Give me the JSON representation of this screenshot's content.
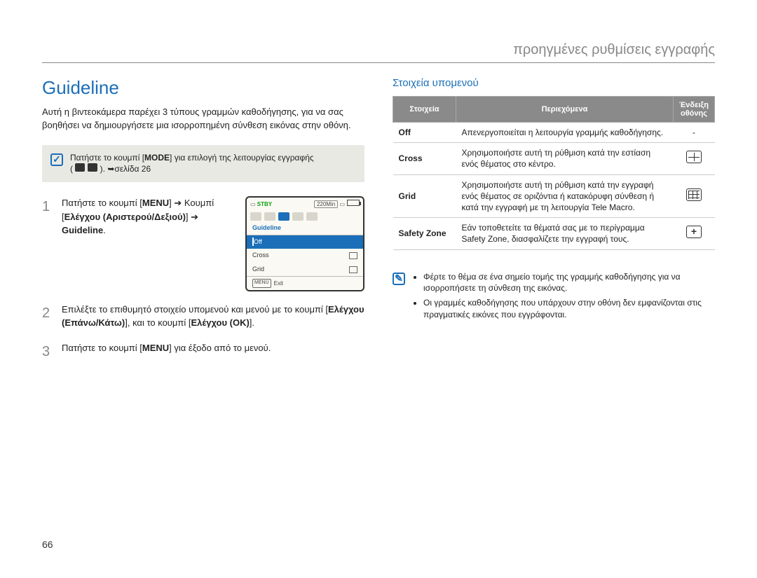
{
  "chapter": "προηγμένες ρυθμίσεις εγγραφής",
  "section_title": "Guideline",
  "intro": "Αυτή η βιντεοκάμερα παρέχει 3 τύπους γραμμών καθοδήγησης, για να σας βοηθήσει να δημιουργήσετε μια ισορροπημένη σύνθεση εικόνας στην οθόνη.",
  "mode_note": {
    "prefix": "Πατήστε το κουμπί [",
    "mode": "MODE",
    "suffix": "] για επιλογή της λειτουργίας εγγραφής",
    "page_ref": "σελίδα 26"
  },
  "steps": [
    {
      "num": "1",
      "prefix": "Πατήστε το κουμπί [",
      "menu": "MENU",
      "mid": "] ➔ Κουμπί [",
      "ctrl": "Ελέγχου (Αριστερού/Δεξιού)",
      "mid2": "] ➔ ",
      "target": "Guideline",
      "end": "."
    },
    {
      "num": "2",
      "prefix": "Επιλέξτε το επιθυμητό στοιχείο υπομενού και μενού με το κουμπί [",
      "ctrl": "Ελέγχου (Επάνω/Κάτω)",
      "mid": "], και το κουμπί [",
      "ctrl2": "Ελέγχου (OK)",
      "end": "]."
    },
    {
      "num": "3",
      "prefix": "Πατήστε το κουμπί [",
      "menu": "MENU",
      "end": "] για έξοδο από το μενού."
    }
  ],
  "lcd": {
    "stby": "STBY",
    "time": "220Min",
    "title": "Guideline",
    "items": [
      "Off",
      "Cross",
      "Grid"
    ],
    "exit_label": "MENU",
    "exit_text": "Exit"
  },
  "submenu_heading": "Στοιχεία υπομενού",
  "table": {
    "headers": [
      "Στοιχεία",
      "Περιεχόμενα",
      "Ένδειξη οθόνης"
    ],
    "rows": [
      {
        "name": "Off",
        "desc": "Απενεργοποιείται η λειτουργία γραμμής καθοδήγησης.",
        "icon": "-"
      },
      {
        "name": "Cross",
        "desc": "Χρησιμοποιήστε αυτή τη ρύθμιση κατά την εστίαση ενός θέματος στο κέντρο.",
        "icon": "cross"
      },
      {
        "name": "Grid",
        "desc": "Χρησιμοποιήστε αυτή τη ρύθμιση κατά την εγγραφή ενός θέματος σε οριζόντια ή κατακόρυφη σύνθεση ή κατά την εγγραφή με τη λειτουργία Tele Macro.",
        "icon": "grid"
      },
      {
        "name": "Safety Zone",
        "desc": "Εάν τοποθετείτε τα θέματά σας με το περίγραμμα Safety Zone, διασφαλίζετε την εγγραφή τους.",
        "icon": "sz"
      }
    ]
  },
  "tips": [
    "Φέρτε το θέμα σε ένα σημείο τομής της γραμμής καθοδήγησης για να ισορροπήσετε τη σύνθεση της εικόνας.",
    "Οι γραμμές καθοδήγησης που υπάρχουν στην οθόνη δεν εμφανίζονται στις πραγματικές εικόνες που εγγράφονται."
  ],
  "page_number": "66"
}
